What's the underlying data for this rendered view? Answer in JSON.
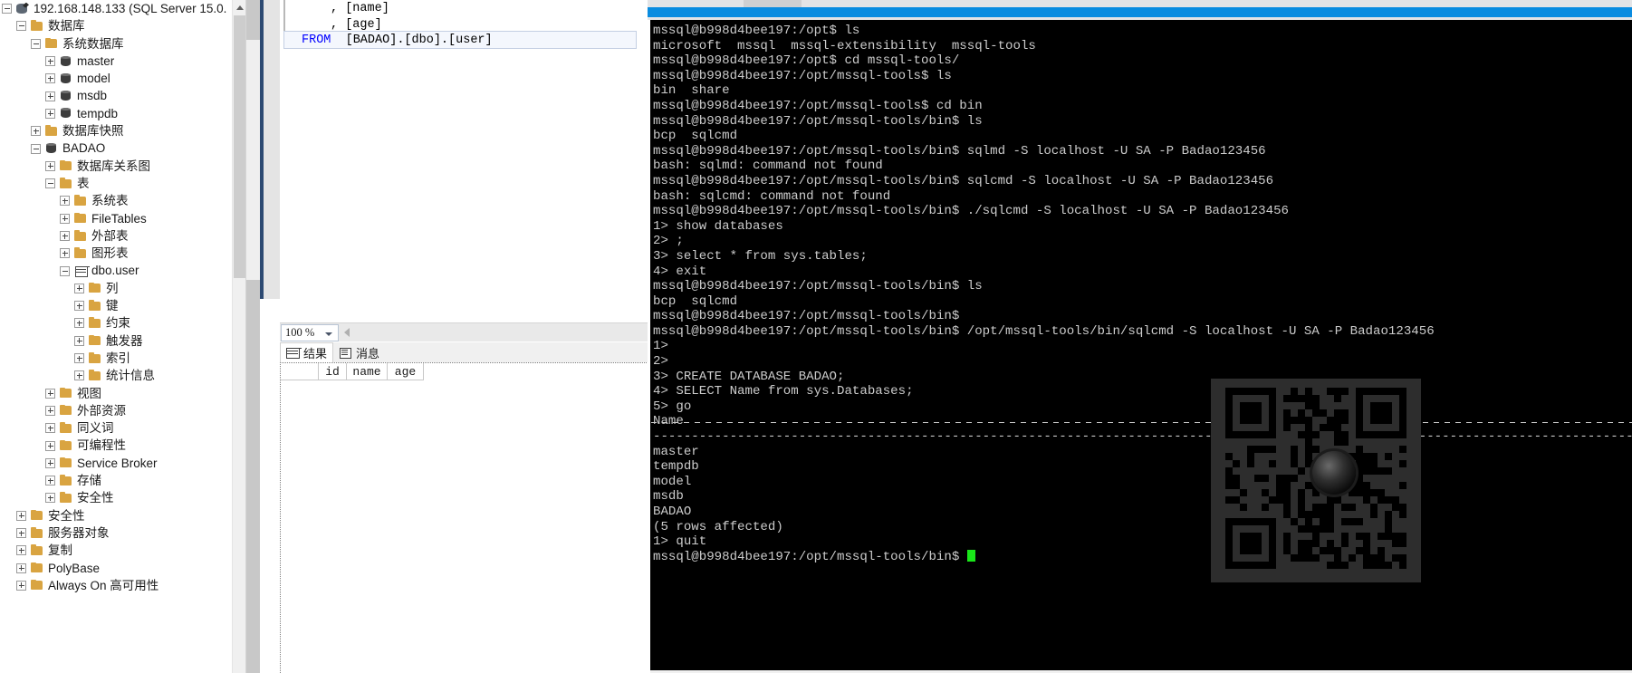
{
  "object_explorer": {
    "scroll_up_icon": "chevron-up-icon",
    "items": [
      {
        "label": "192.168.148.133 (SQL Server 15.0.",
        "depth": 0,
        "icon": "server-icon",
        "toggle": "minus"
      },
      {
        "label": "数据库",
        "depth": 1,
        "icon": "folder-icon",
        "toggle": "minus"
      },
      {
        "label": "系统数据库",
        "depth": 2,
        "icon": "folder-icon",
        "toggle": "minus"
      },
      {
        "label": "master",
        "depth": 3,
        "icon": "database-icon",
        "toggle": "plus"
      },
      {
        "label": "model",
        "depth": 3,
        "icon": "database-icon",
        "toggle": "plus"
      },
      {
        "label": "msdb",
        "depth": 3,
        "icon": "database-icon",
        "toggle": "plus"
      },
      {
        "label": "tempdb",
        "depth": 3,
        "icon": "database-icon",
        "toggle": "plus"
      },
      {
        "label": "数据库快照",
        "depth": 2,
        "icon": "folder-icon",
        "toggle": "plus"
      },
      {
        "label": "BADAO",
        "depth": 2,
        "icon": "database-icon",
        "toggle": "minus"
      },
      {
        "label": "数据库关系图",
        "depth": 3,
        "icon": "folder-icon",
        "toggle": "plus"
      },
      {
        "label": "表",
        "depth": 3,
        "icon": "folder-icon",
        "toggle": "minus"
      },
      {
        "label": "系统表",
        "depth": 4,
        "icon": "folder-icon",
        "toggle": "plus"
      },
      {
        "label": "FileTables",
        "depth": 4,
        "icon": "folder-icon",
        "toggle": "plus"
      },
      {
        "label": "外部表",
        "depth": 4,
        "icon": "folder-icon",
        "toggle": "plus"
      },
      {
        "label": "图形表",
        "depth": 4,
        "icon": "folder-icon",
        "toggle": "plus"
      },
      {
        "label": "dbo.user",
        "depth": 4,
        "icon": "table-icon",
        "toggle": "minus"
      },
      {
        "label": "列",
        "depth": 5,
        "icon": "folder-icon",
        "toggle": "plus"
      },
      {
        "label": "键",
        "depth": 5,
        "icon": "folder-icon",
        "toggle": "plus"
      },
      {
        "label": "约束",
        "depth": 5,
        "icon": "folder-icon",
        "toggle": "plus"
      },
      {
        "label": "触发器",
        "depth": 5,
        "icon": "folder-icon",
        "toggle": "plus"
      },
      {
        "label": "索引",
        "depth": 5,
        "icon": "folder-icon",
        "toggle": "plus"
      },
      {
        "label": "统计信息",
        "depth": 5,
        "icon": "folder-icon",
        "toggle": "plus"
      },
      {
        "label": "视图",
        "depth": 3,
        "icon": "folder-icon",
        "toggle": "plus"
      },
      {
        "label": "外部资源",
        "depth": 3,
        "icon": "folder-icon",
        "toggle": "plus"
      },
      {
        "label": "同义词",
        "depth": 3,
        "icon": "folder-icon",
        "toggle": "plus"
      },
      {
        "label": "可编程性",
        "depth": 3,
        "icon": "folder-icon",
        "toggle": "plus"
      },
      {
        "label": "Service Broker",
        "depth": 3,
        "icon": "folder-icon",
        "toggle": "plus"
      },
      {
        "label": "存储",
        "depth": 3,
        "icon": "folder-icon",
        "toggle": "plus"
      },
      {
        "label": "安全性",
        "depth": 3,
        "icon": "folder-icon",
        "toggle": "plus"
      },
      {
        "label": "安全性",
        "depth": 1,
        "icon": "folder-icon",
        "toggle": "plus"
      },
      {
        "label": "服务器对象",
        "depth": 1,
        "icon": "folder-icon",
        "toggle": "plus"
      },
      {
        "label": "复制",
        "depth": 1,
        "icon": "folder-icon",
        "toggle": "plus"
      },
      {
        "label": "PolyBase",
        "depth": 1,
        "icon": "folder-icon",
        "toggle": "plus"
      },
      {
        "label": "Always On 高可用性",
        "depth": 1,
        "icon": "folder-icon",
        "toggle": "plus"
      }
    ]
  },
  "query_editor": {
    "lines": [
      {
        "indent": 6,
        "text": ", [name]"
      },
      {
        "indent": 6,
        "text": ", [age]"
      },
      {
        "indent": 2,
        "keyword": "FROM",
        "text": "  [BADAO].[dbo].[user]"
      }
    ]
  },
  "zoom_bar": {
    "zoom_value": "100 %",
    "caret_icon": "chevron-down-icon",
    "hscroll_left_icon": "triangle-left-icon"
  },
  "result_tabs": [
    {
      "label": "结果",
      "icon": "grid-icon",
      "active": true
    },
    {
      "label": "消息",
      "icon": "message-icon",
      "active": false
    }
  ],
  "results_grid": {
    "columns": [
      "id",
      "name",
      "age"
    ],
    "rows": []
  },
  "terminal": {
    "title_accent_color": "#0a8ce0",
    "prompt_host": "mssql@b998d4bee197",
    "cursor": "block-cursor",
    "lines": [
      "mssql@b998d4bee197:/opt$ ls",
      "microsoft  mssql  mssql-extensibility  mssql-tools",
      "mssql@b998d4bee197:/opt$ cd mssql-tools/",
      "mssql@b998d4bee197:/opt/mssql-tools$ ls",
      "bin  share",
      "mssql@b998d4bee197:/opt/mssql-tools$ cd bin",
      "mssql@b998d4bee197:/opt/mssql-tools/bin$ ls",
      "bcp  sqlcmd",
      "mssql@b998d4bee197:/opt/mssql-tools/bin$ sqlmd -S localhost -U SA -P Badao123456",
      "bash: sqlmd: command not found",
      "mssql@b998d4bee197:/opt/mssql-tools/bin$ sqlcmd -S localhost -U SA -P Badao123456",
      "bash: sqlcmd: command not found",
      "mssql@b998d4bee197:/opt/mssql-tools/bin$ ./sqlcmd -S localhost -U SA -P Badao123456",
      "1> show databases",
      "2> ;",
      "3> select * from sys.tables;",
      "4> exit",
      "mssql@b998d4bee197:/opt/mssql-tools/bin$ ls",
      "bcp  sqlcmd",
      "mssql@b998d4bee197:/opt/mssql-tools/bin$",
      "mssql@b998d4bee197:/opt/mssql-tools/bin$ /opt/mssql-tools/bin/sqlcmd -S localhost -U SA -P Badao123456",
      "1>",
      "2>",
      "3> CREATE DATABASE BADAO;",
      "4> SELECT Name from sys.Databases;",
      "5> go",
      "Name",
      "--------------------------------------------------------------------------------------------------------------------------------",
      "master",
      "tempdb",
      "model",
      "msdb",
      "BADAO",
      "",
      "(5 rows affected)",
      "1> quit"
    ],
    "final_prompt": "mssql@b998d4bee197:/opt/mssql-tools/bin$ "
  },
  "qr_overlay": {
    "name": "qr-code-watermark"
  }
}
